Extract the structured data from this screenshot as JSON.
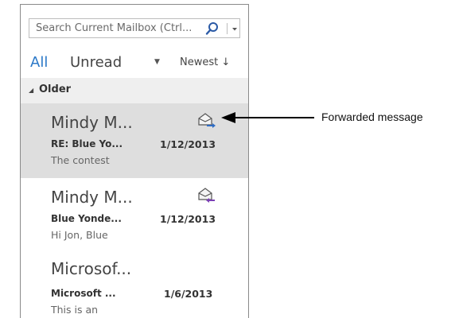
{
  "search": {
    "placeholder": "Search Current Mailbox (Ctrl..."
  },
  "filters": {
    "all_label": "All",
    "unread_label": "Unread",
    "sort_label": "Newest ↓"
  },
  "group": {
    "label": "Older"
  },
  "messages": [
    {
      "sender": "Mindy M...",
      "subject": "RE: Blue Yo...",
      "date": "1/12/2013",
      "preview": "The contest",
      "status_icon": "forwarded-envelope-icon",
      "selected": true
    },
    {
      "sender": "Mindy M...",
      "subject": "Blue Yonde...",
      "date": "1/12/2013",
      "preview": "Hi Jon,  Blue",
      "status_icon": "replied-envelope-icon",
      "selected": false
    },
    {
      "sender": "Microsof...",
      "subject": "Microsoft ...",
      "date": "1/6/2013",
      "preview": "This is an",
      "status_icon": "",
      "selected": false
    }
  ],
  "callout": {
    "label": "Forwarded message"
  },
  "colors": {
    "accent": "#2b78c8",
    "selected_bg": "#dedede",
    "group_bg": "#efefef"
  }
}
